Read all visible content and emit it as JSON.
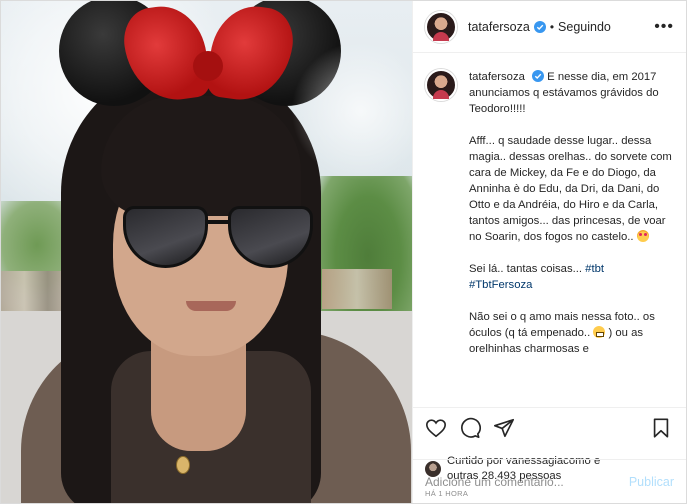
{
  "post_author": {
    "username": "tatafersoza",
    "follow_status": "Seguindo",
    "separator": "•",
    "more_label": "•••"
  },
  "caption": {
    "username": "tatafersoza",
    "paragraphs": [
      "E nesse dia, em 2017 anunciamos q estávamos grávidos do Teodoro!!!!!",
      "Afff... q saudade desse lugar.. dessa magia.. dessas orelhas.. do sorvete com cara de Mickey, da Fe e do Diogo, da Anninha è do Edu, da Dri, da Dani, do Otto e da Andréia, do Hiro e da Carla, tantos amigos... das princesas, de voar no Soarin, dos fogos no castelo..",
      "Sei lá.. tantas coisas...",
      "Não sei o q amo mais nessa foto.. os óculos (q tá empenado..",
      ") ou as orelhinhas charmosas e"
    ],
    "hashtag_tbt": "#tbt",
    "hashtag_tbtfersoza": "#TbtFersoza"
  },
  "likes": {
    "liked_by_label": "Curtido por",
    "liked_by_user": "vanessagiacomo",
    "and_label": "e",
    "others_label": "outras 28.493 pessoas"
  },
  "timestamp": "HÁ 1 HORA",
  "composer": {
    "placeholder": "Adicione um comentário...",
    "publish_label": "Publicar"
  },
  "icons": {
    "verified": "verified-badge-icon",
    "like": "heart-icon",
    "comment": "comment-bubble-icon",
    "share": "paper-plane-icon",
    "save": "bookmark-icon"
  },
  "colors": {
    "verified_blue": "#3897f0",
    "hashtag": "#00376b",
    "publish_disabled": "#b2dffc",
    "muted": "#8e8e8e"
  }
}
